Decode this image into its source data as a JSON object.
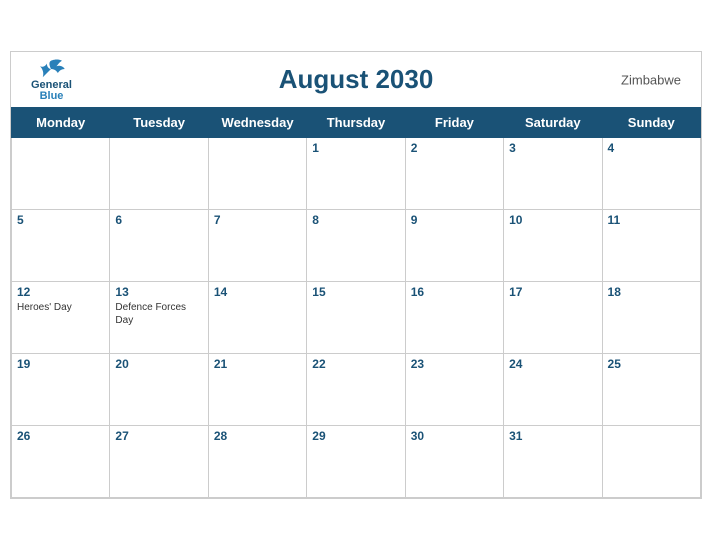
{
  "header": {
    "logo_general": "General",
    "logo_blue": "Blue",
    "title": "August 2030",
    "country": "Zimbabwe"
  },
  "weekdays": [
    "Monday",
    "Tuesday",
    "Wednesday",
    "Thursday",
    "Friday",
    "Saturday",
    "Sunday"
  ],
  "weeks": [
    [
      {
        "date": "",
        "holiday": ""
      },
      {
        "date": "",
        "holiday": ""
      },
      {
        "date": "",
        "holiday": ""
      },
      {
        "date": "1",
        "holiday": ""
      },
      {
        "date": "2",
        "holiday": ""
      },
      {
        "date": "3",
        "holiday": ""
      },
      {
        "date": "4",
        "holiday": ""
      }
    ],
    [
      {
        "date": "5",
        "holiday": ""
      },
      {
        "date": "6",
        "holiday": ""
      },
      {
        "date": "7",
        "holiday": ""
      },
      {
        "date": "8",
        "holiday": ""
      },
      {
        "date": "9",
        "holiday": ""
      },
      {
        "date": "10",
        "holiday": ""
      },
      {
        "date": "11",
        "holiday": ""
      }
    ],
    [
      {
        "date": "12",
        "holiday": "Heroes' Day"
      },
      {
        "date": "13",
        "holiday": "Defence Forces Day"
      },
      {
        "date": "14",
        "holiday": ""
      },
      {
        "date": "15",
        "holiday": ""
      },
      {
        "date": "16",
        "holiday": ""
      },
      {
        "date": "17",
        "holiday": ""
      },
      {
        "date": "18",
        "holiday": ""
      }
    ],
    [
      {
        "date": "19",
        "holiday": ""
      },
      {
        "date": "20",
        "holiday": ""
      },
      {
        "date": "21",
        "holiday": ""
      },
      {
        "date": "22",
        "holiday": ""
      },
      {
        "date": "23",
        "holiday": ""
      },
      {
        "date": "24",
        "holiday": ""
      },
      {
        "date": "25",
        "holiday": ""
      }
    ],
    [
      {
        "date": "26",
        "holiday": ""
      },
      {
        "date": "27",
        "holiday": ""
      },
      {
        "date": "28",
        "holiday": ""
      },
      {
        "date": "29",
        "holiday": ""
      },
      {
        "date": "30",
        "holiday": ""
      },
      {
        "date": "31",
        "holiday": ""
      },
      {
        "date": "",
        "holiday": ""
      }
    ]
  ]
}
